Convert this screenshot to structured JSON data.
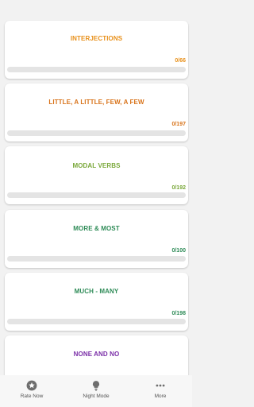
{
  "topics": [
    {
      "title": "INTERJECTIONS",
      "count": "0/66",
      "progress": 0,
      "color": "#e8901a"
    },
    {
      "title": "LITTLE, A LITTLE, FEW, A FEW",
      "count": "0/197",
      "progress": 0,
      "color": "#d8731a"
    },
    {
      "title": "MODAL VERBS",
      "count": "0/192",
      "progress": 0,
      "color": "#7aa83a"
    },
    {
      "title": "MORE & MOST",
      "count": "0/100",
      "progress": 0,
      "color": "#2e8b57"
    },
    {
      "title": "MUCH - MANY",
      "count": "0/198",
      "progress": 0,
      "color": "#2e8b57"
    },
    {
      "title": "NONE AND NO",
      "count": "",
      "progress": 0,
      "color": "#7b2fa8"
    }
  ],
  "bottom_nav": [
    {
      "label": "Rate Now",
      "icon": "star-icon"
    },
    {
      "label": "Night Mode",
      "icon": "lightbulb-icon"
    },
    {
      "label": "More",
      "icon": "more-dots-icon"
    }
  ]
}
